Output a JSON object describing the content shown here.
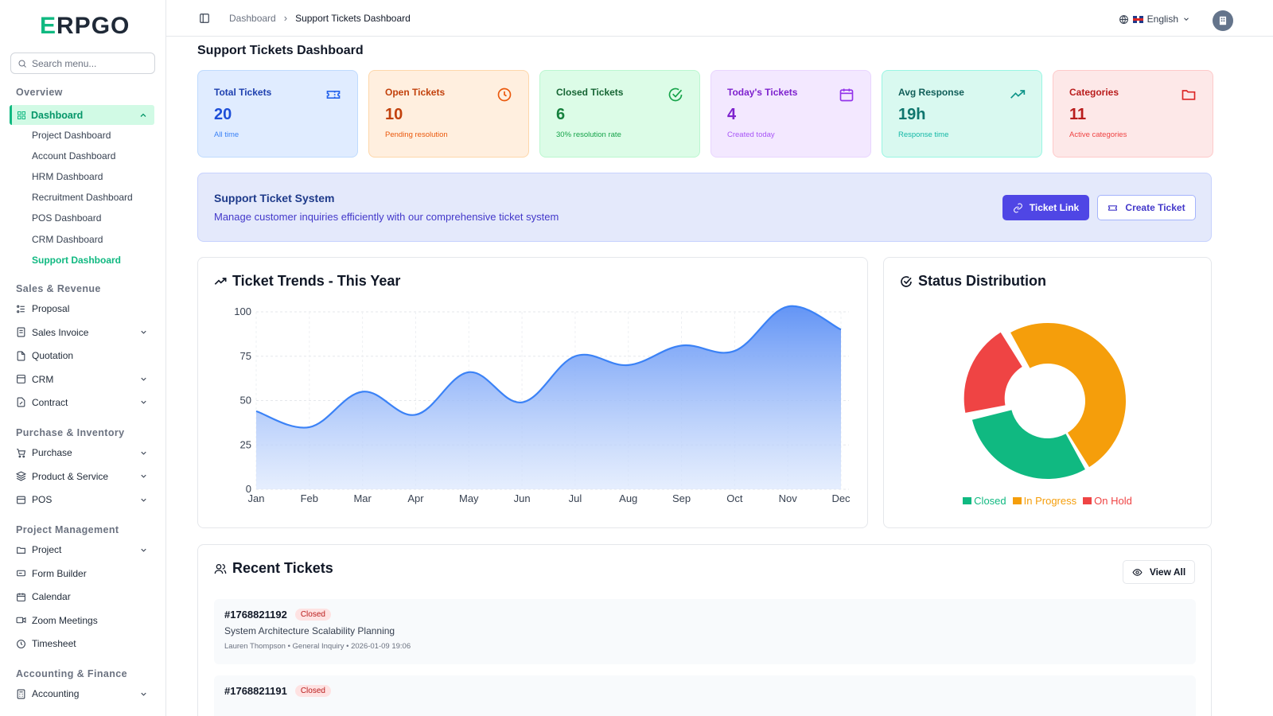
{
  "app": {
    "logo": "ERPGO"
  },
  "sidebar": {
    "search_placeholder": "Search menu...",
    "overview_label": "Overview",
    "dashboard_label": "Dashboard",
    "dashboard_subitems": [
      "Project Dashboard",
      "Account Dashboard",
      "HRM Dashboard",
      "Recruitment Dashboard",
      "POS Dashboard",
      "CRM Dashboard",
      "Support Dashboard"
    ],
    "sections": [
      {
        "title": "Sales & Revenue",
        "items": [
          {
            "label": "Proposal",
            "icon": "proposal-icon",
            "chevron": false
          },
          {
            "label": "Sales Invoice",
            "icon": "invoice-icon",
            "chevron": true
          },
          {
            "label": "Quotation",
            "icon": "quotation-icon",
            "chevron": false
          },
          {
            "label": "CRM",
            "icon": "crm-icon",
            "chevron": true
          },
          {
            "label": "Contract",
            "icon": "contract-icon",
            "chevron": true
          }
        ]
      },
      {
        "title": "Purchase & Inventory",
        "items": [
          {
            "label": "Purchase",
            "icon": "cart-icon",
            "chevron": true
          },
          {
            "label": "Product & Service",
            "icon": "layers-icon",
            "chevron": true
          },
          {
            "label": "POS",
            "icon": "pos-icon",
            "chevron": true
          }
        ]
      },
      {
        "title": "Project Management",
        "items": [
          {
            "label": "Project",
            "icon": "folder-icon",
            "chevron": true
          },
          {
            "label": "Form Builder",
            "icon": "form-icon",
            "chevron": false
          },
          {
            "label": "Calendar",
            "icon": "calendar-icon",
            "chevron": false
          },
          {
            "label": "Zoom Meetings",
            "icon": "video-icon",
            "chevron": false
          },
          {
            "label": "Timesheet",
            "icon": "clock-icon",
            "chevron": false
          }
        ]
      },
      {
        "title": "Accounting & Finance",
        "items": [
          {
            "label": "Accounting",
            "icon": "accounting-icon",
            "chevron": true
          }
        ]
      }
    ]
  },
  "header": {
    "breadcrumb": [
      "Dashboard",
      "Support Tickets Dashboard"
    ],
    "language": "English"
  },
  "page": {
    "title": "Support Tickets Dashboard",
    "stats": [
      {
        "label": "Total Tickets",
        "value": "20",
        "sub": "All time",
        "icon": "ticket-icon"
      },
      {
        "label": "Open Tickets",
        "value": "10",
        "sub": "Pending resolution",
        "icon": "clock-icon"
      },
      {
        "label": "Closed Tickets",
        "value": "6",
        "sub": "30% resolution rate",
        "icon": "check-circle-icon"
      },
      {
        "label": "Today's Tickets",
        "value": "4",
        "sub": "Created today",
        "icon": "calendar-icon"
      },
      {
        "label": "Avg Response",
        "value": "19h",
        "sub": "Response time",
        "icon": "trending-up-icon"
      },
      {
        "label": "Categories",
        "value": "11",
        "sub": "Active categories",
        "icon": "folder-icon"
      }
    ],
    "banner": {
      "title": "Support Ticket System",
      "subtitle": "Manage customer inquiries efficiently with our comprehensive ticket system",
      "ticket_link_label": "Ticket Link",
      "create_ticket_label": "Create Ticket"
    },
    "trend_title": "Ticket Trends - This Year",
    "status_title": "Status Distribution",
    "recent": {
      "title": "Recent Tickets",
      "view_all_label": "View All",
      "tickets": [
        {
          "id": "#1768821192",
          "status": "Closed",
          "subject": "System Architecture Scalability Planning",
          "meta": "Lauren Thompson • General Inquiry • 2026-01-09 19:06"
        },
        {
          "id": "#1768821191",
          "status": "Closed",
          "subject": "",
          "meta": ""
        }
      ]
    }
  },
  "colors": {
    "accent": "#10b981",
    "primary_button": "#4f46e5",
    "line": "#3b82f6",
    "closed": "#10b981",
    "in_progress": "#f59e0b",
    "on_hold": "#ef4444"
  },
  "chart_data": [
    {
      "type": "area",
      "title": "Ticket Trends - This Year",
      "categories": [
        "Jan",
        "Feb",
        "Mar",
        "Apr",
        "May",
        "Jun",
        "Jul",
        "Aug",
        "Sep",
        "Oct",
        "Nov",
        "Dec"
      ],
      "values": [
        44,
        35,
        55,
        42,
        66,
        49,
        75,
        70,
        81,
        78,
        103,
        90
      ],
      "ylim": [
        0,
        100
      ],
      "yticks": [
        0,
        25,
        50,
        75,
        100
      ],
      "grid": true
    },
    {
      "type": "pie",
      "title": "Status Distribution",
      "labels": [
        "Closed",
        "In Progress",
        "On Hold"
      ],
      "values": [
        6,
        10,
        4
      ],
      "colors": [
        "#10b981",
        "#f59e0b",
        "#ef4444"
      ],
      "legend": "bottom"
    }
  ]
}
